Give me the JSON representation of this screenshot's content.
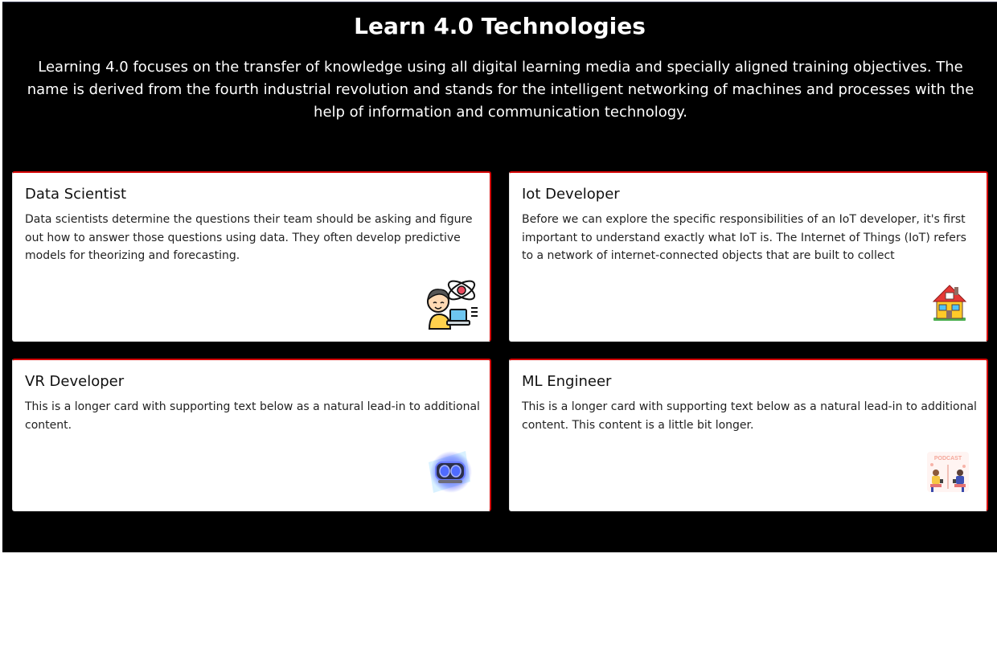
{
  "header": {
    "title": "Learn 4.0 Technologies",
    "intro": "Learning 4.0 focuses on the transfer of knowledge using all digital learning media and specially aligned training objectives. The name is derived from the fourth industrial revolution and stands for the intelligent networking of machines and processes with the help of information and communication technology."
  },
  "cards": [
    {
      "title": "Data Scientist",
      "text": "Data scientists determine the questions their team should be asking and figure out how to answer those questions using data. They often develop predictive models for theorizing and forecasting.",
      "icon": "data-scientist-illustration"
    },
    {
      "title": "Iot Developer",
      "text": "Before we can explore the specific responsibilities of an IoT developer, it's first important to understand exactly what IoT is. The Internet of Things (IoT) refers to a network of internet-connected objects that are built to collect",
      "icon": "smart-house-illustration"
    },
    {
      "title": "VR Developer",
      "text": "This is a longer card with supporting text below as a natural lead-in to additional content.",
      "icon": "vr-headset-illustration"
    },
    {
      "title": "ML Engineer",
      "text": "This is a longer card with supporting text below as a natural lead-in to additional content. This content is a little bit longer.",
      "icon": "podcast-illustration",
      "illustration_text": "PODCAST"
    }
  ],
  "colors": {
    "background": "#000000",
    "card_border_accent": "#d40000",
    "card_background": "#ffffff"
  }
}
